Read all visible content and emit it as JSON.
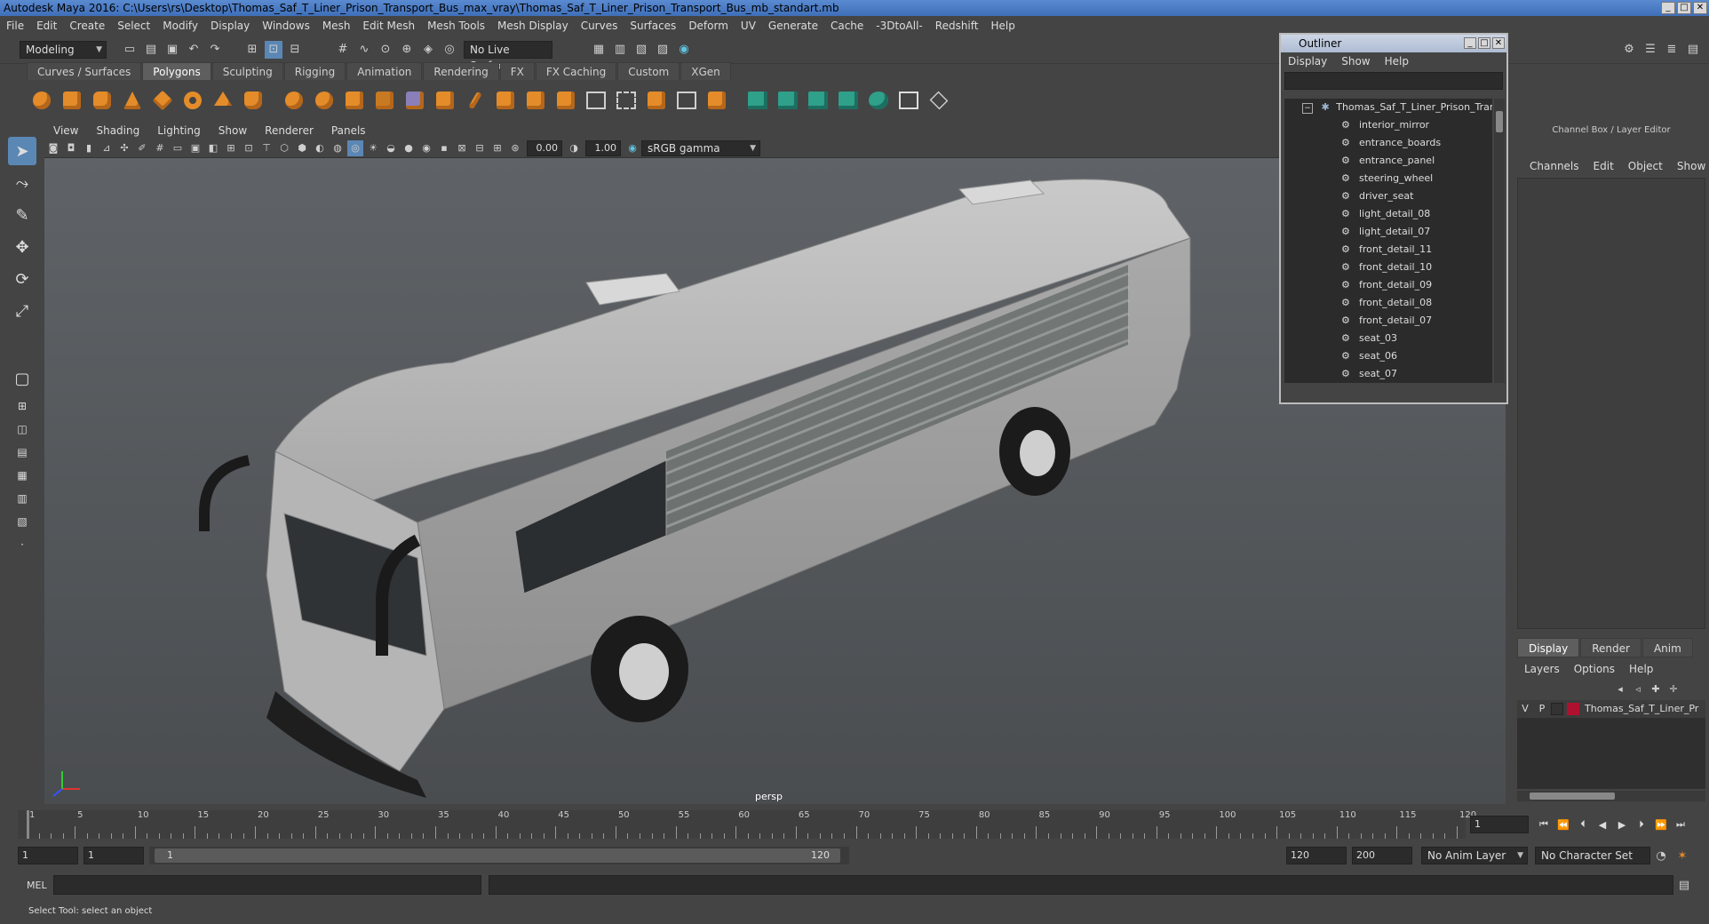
{
  "window": {
    "title": "Autodesk Maya 2016: C:\\Users\\rs\\Desktop\\Thomas_Saf_T_Liner_Prison_Transport_Bus_max_vray\\Thomas_Saf_T_Liner_Prison_Transport_Bus_mb_standart.mb",
    "min": "_",
    "max": "□",
    "close": "✕"
  },
  "menubar": [
    "File",
    "Edit",
    "Create",
    "Select",
    "Modify",
    "Display",
    "Windows",
    "Mesh",
    "Edit Mesh",
    "Mesh Tools",
    "Mesh Display",
    "Curves",
    "Surfaces",
    "Deform",
    "UV",
    "Generate",
    "Cache",
    "-3DtoAll-",
    "Redshift",
    "Help"
  ],
  "status": {
    "mode": "Modeling",
    "live_surface": "No Live Surface"
  },
  "shelf_tabs": [
    "Curves / Surfaces",
    "Polygons",
    "Sculpting",
    "Rigging",
    "Animation",
    "Rendering",
    "FX",
    "FX Caching",
    "Custom",
    "XGen"
  ],
  "shelf_active": "Polygons",
  "viewport": {
    "menu": [
      "View",
      "Shading",
      "Lighting",
      "Show",
      "Renderer",
      "Panels"
    ],
    "exposure": "0.00",
    "gamma": "1.00",
    "color_space": "sRGB gamma",
    "camera_label": "persp"
  },
  "outliner": {
    "title": "Outliner",
    "menu": [
      "Display",
      "Show",
      "Help"
    ],
    "root": "Thomas_Saf_T_Liner_Prison_Transp",
    "items": [
      "interior_mirror",
      "entrance_boards",
      "entrance_panel",
      "steering_wheel",
      "driver_seat",
      "light_detail_08",
      "light_detail_07",
      "front_detail_11",
      "front_detail_10",
      "front_detail_09",
      "front_detail_08",
      "front_detail_07",
      "seat_03",
      "seat_06",
      "seat_07"
    ]
  },
  "channelbox": {
    "title": "Channel Box / Layer Editor",
    "menu": [
      "Channels",
      "Edit",
      "Object",
      "Show"
    ],
    "layer_tabs": [
      "Display",
      "Render",
      "Anim"
    ],
    "layer_menu": [
      "Layers",
      "Options",
      "Help"
    ],
    "layer": {
      "v": "V",
      "p": "P",
      "name": "Thomas_Saf_T_Liner_Pr",
      "color": "#b01030"
    }
  },
  "timeslider": {
    "ticks": [
      1,
      5,
      10,
      15,
      20,
      25,
      30,
      35,
      40,
      45,
      50,
      55,
      60,
      65,
      70,
      75,
      80,
      85,
      90,
      95,
      100,
      105,
      110,
      115,
      120
    ],
    "current_frame": "1"
  },
  "range": {
    "start": "1",
    "playback_start": "1",
    "slider_start": "1",
    "slider_end": "120",
    "playback_end": "120",
    "end": "200",
    "anim_layer": "No Anim Layer",
    "character_set": "No Character Set"
  },
  "cmdline": {
    "lang": "MEL"
  },
  "helpline": {
    "text": "Select Tool: select an object"
  }
}
